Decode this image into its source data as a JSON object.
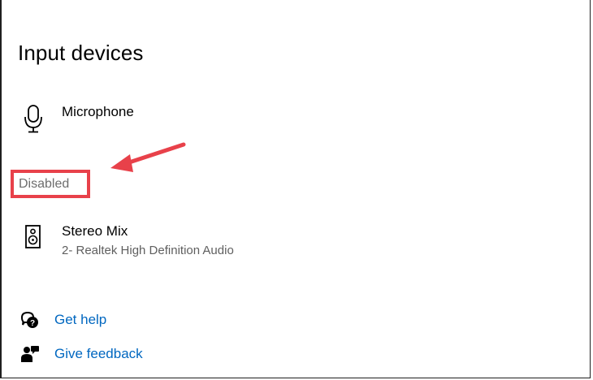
{
  "section": {
    "title": "Input devices",
    "status_label": "Disabled"
  },
  "devices": [
    {
      "name": "Microphone",
      "subtitle": "",
      "icon": "microphone-icon"
    },
    {
      "name": "Stereo Mix",
      "subtitle": "2- Realtek High Definition Audio",
      "icon": "speaker-icon"
    }
  ],
  "links": {
    "help": {
      "label": "Get help",
      "icon": "help-chat-icon"
    },
    "feedback": {
      "label": "Give feedback",
      "icon": "feedback-person-icon"
    }
  },
  "colors": {
    "highlight": "#e8414a",
    "link": "#0067c0",
    "muted": "#6d6d6d"
  }
}
